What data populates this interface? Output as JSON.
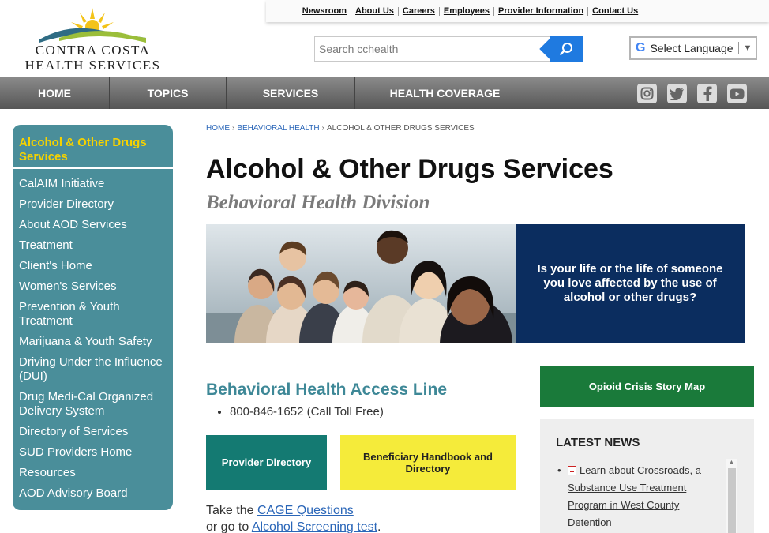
{
  "header": {
    "logo_line1": "CONTRA COSTA",
    "logo_line2": "HEALTH SERVICES",
    "utility_links": [
      "Newsroom",
      "About Us",
      "Careers",
      "Employees",
      "Provider Information",
      "Contact Us"
    ],
    "search_placeholder": "Search cchealth",
    "translate_label": "Select Language"
  },
  "nav": {
    "items": [
      "HOME",
      "TOPICS",
      "SERVICES",
      "HEALTH COVERAGE"
    ],
    "social_icons": [
      "instagram-icon",
      "twitter-icon",
      "facebook-icon",
      "youtube-icon"
    ]
  },
  "sidebar": {
    "active": "Alcohol & Other Drugs Services",
    "items": [
      "CalAIM Initiative",
      "Provider Directory",
      "About AOD Services",
      "Treatment",
      "Client's Home",
      "Women's Services",
      "Prevention & Youth Treatment",
      "Marijuana & Youth Safety",
      "Driving Under the Influence (DUI)",
      "Drug Medi-Cal Organized Delivery System",
      "Directory of Services",
      "SUD Providers Home",
      "Resources",
      "AOD Advisory Board"
    ]
  },
  "breadcrumb": {
    "home": "HOME",
    "parent": "BEHAVIORAL HEALTH",
    "current": "ALCOHOL & OTHER DRUGS SERVICES"
  },
  "main": {
    "title": "Alcohol & Other Drugs Services",
    "subtitle": "Behavioral Health Division",
    "hero_text": "Is your life or the life of someone you love affected by the use of alcohol or other drugs?",
    "access_title": "Behavioral Health Access Line",
    "phone": "800-846-1652 (Call Toll Free)",
    "btn_provider": "Provider Directory",
    "btn_handbook": "Beneficiary Handbook and Directory",
    "cage_prefix": "Take the",
    "cage_link": "CAGE Questions",
    "cage_or": "or go to",
    "screening_link": "Alcohol Screening test",
    "screening_suffix": "."
  },
  "right": {
    "opioid_button": "Opioid Crisis Story Map",
    "news_heading": "LATEST NEWS",
    "news_items": [
      "Learn about Crossroads, a Substance Use Treatment Program in West County Detention"
    ]
  },
  "colors": {
    "sidebar_bg": "#4a8e9a",
    "sidebar_active": "#f5d200",
    "hero_cta_bg": "#0b2d5f",
    "provider_btn": "#147a72",
    "handbook_btn": "#f5eb3a",
    "opioid_btn": "#1a7a3a",
    "accent_title": "#3e8897"
  }
}
